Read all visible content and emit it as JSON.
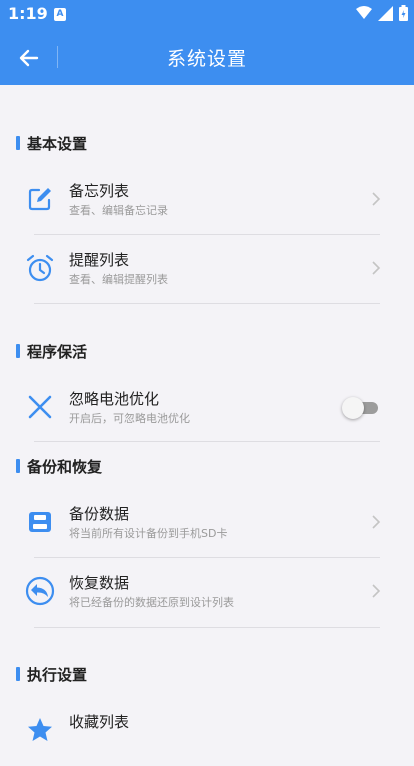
{
  "status": {
    "time": "1:19",
    "notif_letter": "A"
  },
  "appbar": {
    "title": "系统设置"
  },
  "sections": [
    {
      "title": "基本设置",
      "items": [
        {
          "label": "备忘列表",
          "sub": "查看、编辑备忘记录",
          "icon": "edit-note-icon"
        },
        {
          "label": "提醒列表",
          "sub": "查看、编辑提醒列表",
          "icon": "alarm-clock-icon"
        }
      ]
    },
    {
      "title": "程序保活",
      "items": [
        {
          "label": "忽略电池优化",
          "sub": "开启后，可忽略电池优化",
          "icon": "close-x-icon",
          "toggle": false
        }
      ]
    },
    {
      "title": "备份和恢复",
      "items": [
        {
          "label": "备份数据",
          "sub": "将当前所有设计备份到手机SD卡",
          "icon": "save-disk-icon"
        },
        {
          "label": "恢复数据",
          "sub": "将已经备份的数据还原到设计列表",
          "icon": "restore-arrow-icon"
        }
      ]
    },
    {
      "title": "执行设置",
      "items": [
        {
          "label": "收藏列表",
          "icon": "star-icon"
        }
      ]
    }
  ],
  "colors": {
    "accent": "#3d8ef0",
    "background": "#f4f3f7"
  }
}
